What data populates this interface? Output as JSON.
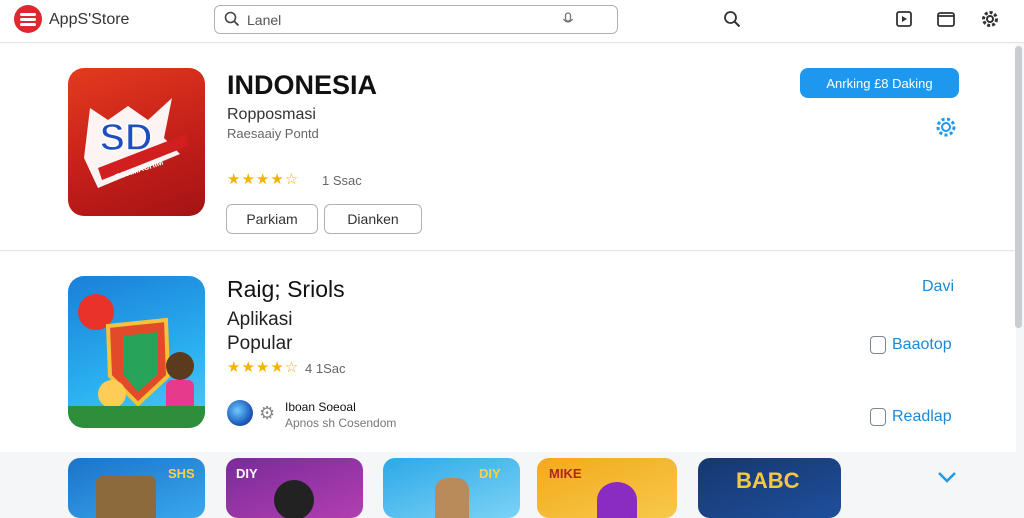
{
  "header": {
    "brand": "AppS'Store",
    "search_value": "Lanel",
    "search_icon": "search-icon",
    "mic_icon": "mic-icon"
  },
  "featured": {
    "title": "INDONESIA",
    "subtitle": "Ropposmasi",
    "category": "Raesaaiy Pontd",
    "rating_stars": "★★★★☆",
    "rating_count": "1 Ssac",
    "buttons": [
      "Parkiam",
      "Dianken"
    ],
    "primary_action": "Anrking £8 Daking",
    "icon_text": "SD",
    "icon_banner": "FORMACHIM"
  },
  "app2": {
    "title": "Raig; Sriols",
    "desc_line1": "Aplikasi",
    "desc_line2": "Popular",
    "rating_stars": "★★★★☆",
    "rating_count": "4 1Sac",
    "developer": "Iboan Soeoal",
    "developer_sub": "Apnos sh Cosendom",
    "link_right": "Davi",
    "action_1": "Baaotop",
    "action_2": "Readlap"
  },
  "thumbnails": [
    {
      "label": "SHS",
      "color": "#1b73c9"
    },
    {
      "label": "DIY",
      "color": "#7a2a9a"
    },
    {
      "label": "DIY",
      "color": "#2da8e8"
    },
    {
      "label": "MIKE",
      "color": "#f3a91c"
    },
    {
      "label": "BABC",
      "color": "#16376f"
    }
  ],
  "colors": {
    "accent": "#1e97ee",
    "star": "#f4b400",
    "brand_red": "#e0262f"
  }
}
